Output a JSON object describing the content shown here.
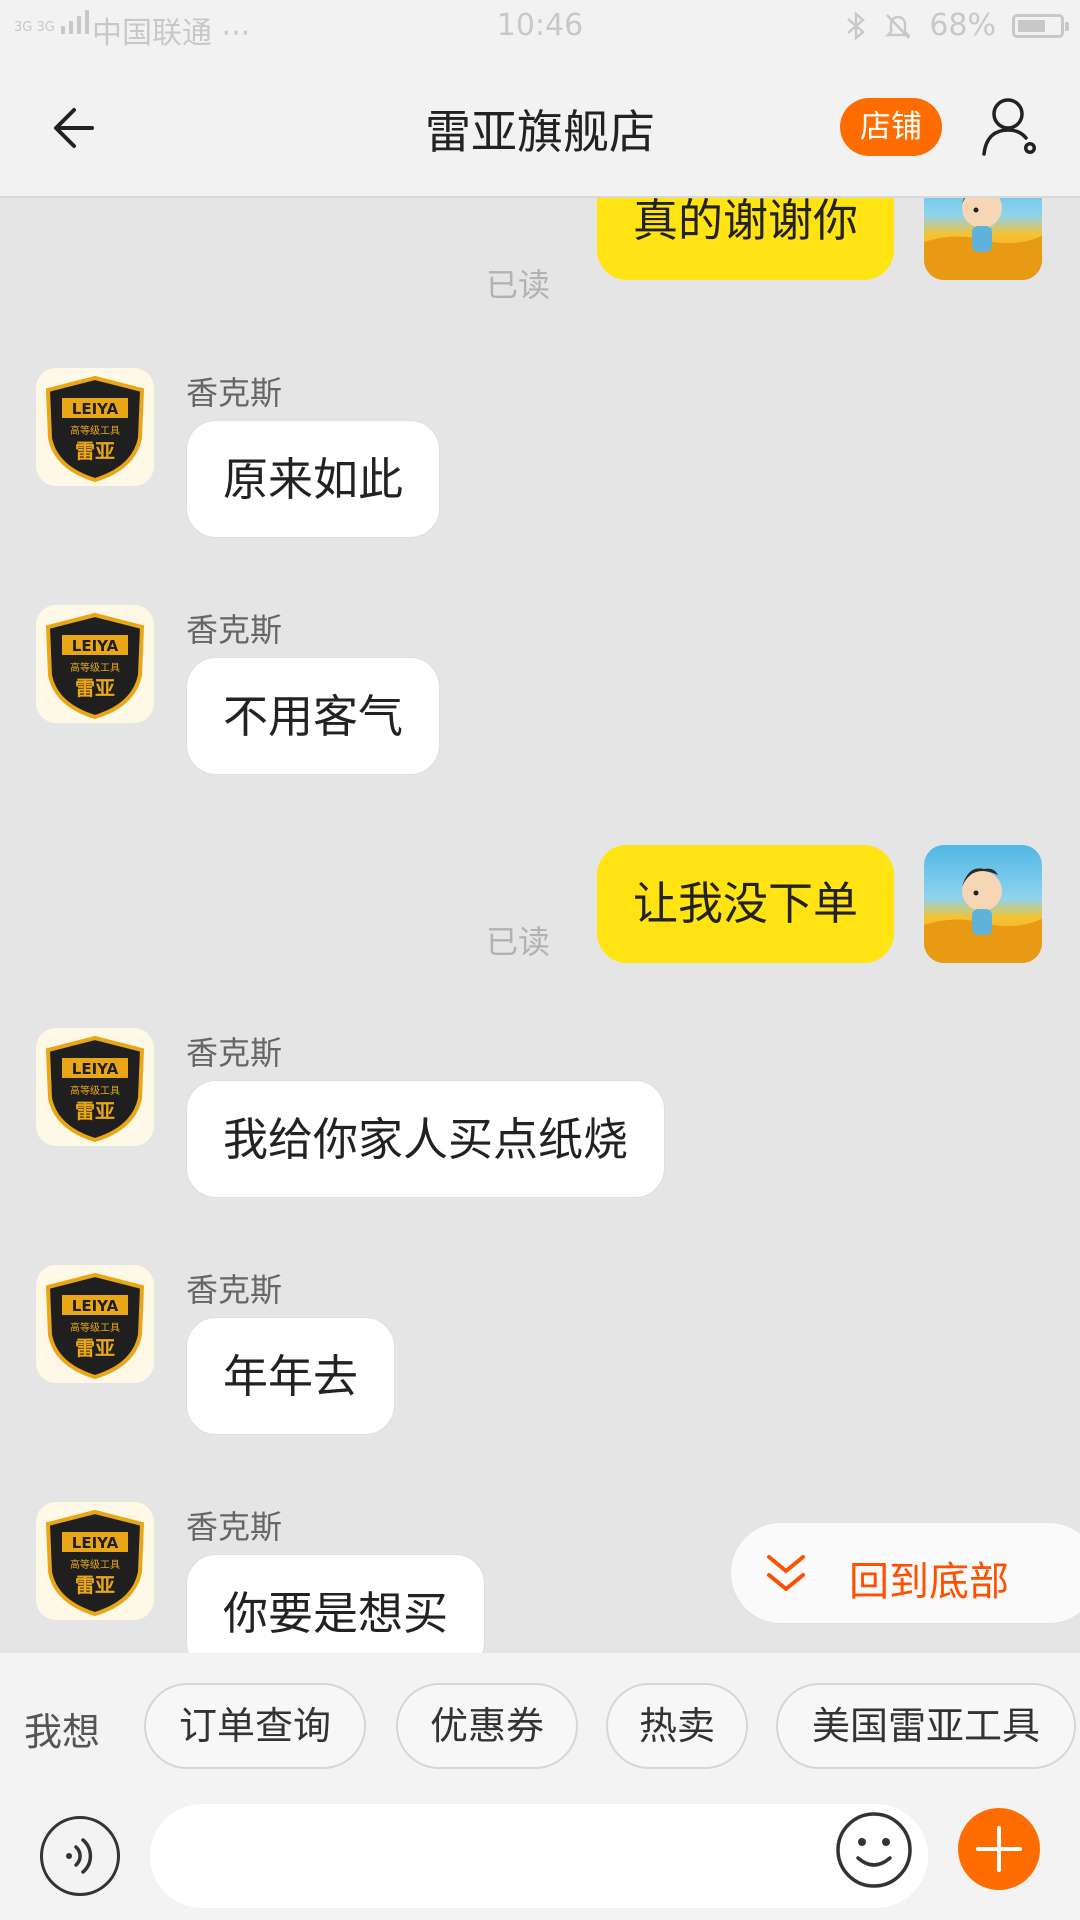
{
  "status_bar": {
    "network": "3G 3G",
    "carrier": "中国联通 ···",
    "time": "10:46",
    "battery": "68%",
    "battery_level": 0.68
  },
  "header": {
    "title": "雷亚旗舰店",
    "shop_button": "店铺"
  },
  "chat": {
    "shop_logo": {
      "top": "LEIYA",
      "middle": "高等级工具",
      "bottom": "雷亚"
    },
    "read_label": "已读",
    "messages": [
      {
        "from": "me",
        "text": "真的谢谢你",
        "status": "已读"
      },
      {
        "from": "shop",
        "sender": "香克斯",
        "text": "原来如此"
      },
      {
        "from": "shop",
        "sender": "香克斯",
        "text": "不用客气"
      },
      {
        "from": "me",
        "text": "让我没下单",
        "status": "已读"
      },
      {
        "from": "shop",
        "sender": "香克斯",
        "text": "我给你家人买点纸烧"
      },
      {
        "from": "shop",
        "sender": "香克斯",
        "text": "年年去"
      },
      {
        "from": "shop",
        "sender": "香克斯",
        "text": "你要是想买"
      }
    ]
  },
  "back_to_bottom": "回到底部",
  "quick_bar": {
    "label": "我想",
    "chips": [
      "订单查询",
      "优惠券",
      "热卖",
      "美国雷亚工具"
    ]
  },
  "colors": {
    "accent": "#ff6d00",
    "my_bubble": "#ffe312",
    "back_to_bottom_text": "#ff5000",
    "chat_bg": "#e5e5e5"
  }
}
